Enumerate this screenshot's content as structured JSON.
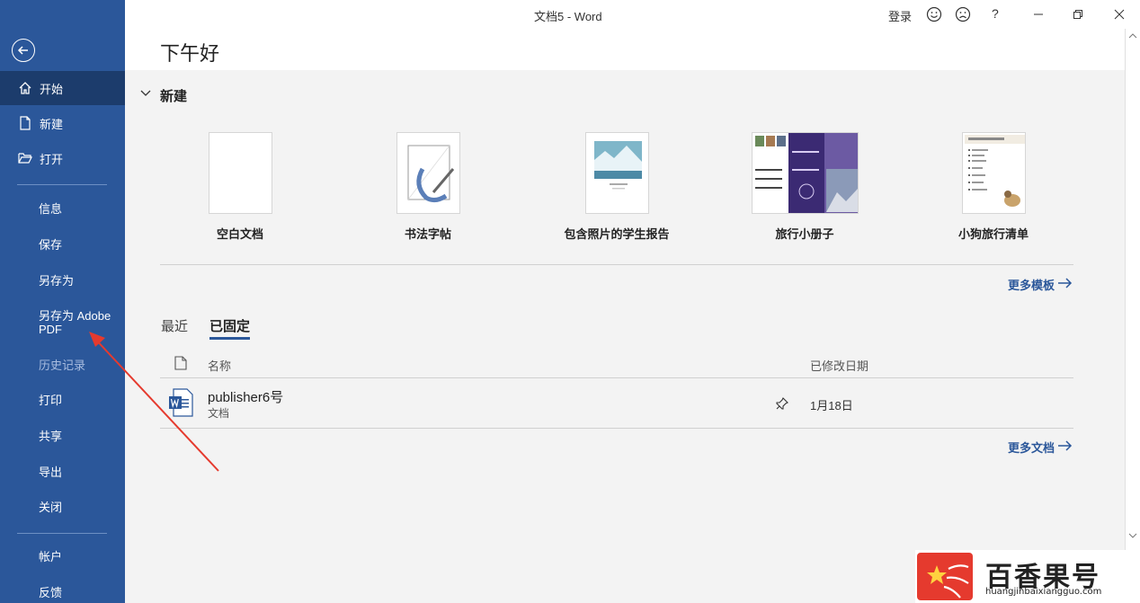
{
  "window": {
    "title": "文档5  -  Word",
    "login_label": "登录",
    "help_label": "?"
  },
  "sidebar": {
    "primary": [
      {
        "label": "开始",
        "icon": "home-icon",
        "active": true
      },
      {
        "label": "新建",
        "icon": "new-doc-icon"
      },
      {
        "label": "打开",
        "icon": "folder-open-icon"
      }
    ],
    "secondary": [
      {
        "label": "信息"
      },
      {
        "label": "保存"
      },
      {
        "label": "另存为"
      },
      {
        "label": "另存为 Adobe PDF"
      },
      {
        "label": "历史记录",
        "disabled": true
      },
      {
        "label": "打印"
      },
      {
        "label": "共享"
      },
      {
        "label": "导出"
      },
      {
        "label": "关闭"
      }
    ],
    "footer": [
      {
        "label": "帐户"
      },
      {
        "label": "反馈"
      }
    ]
  },
  "main": {
    "greeting": "下午好",
    "new_section": {
      "title": "新建",
      "templates": [
        {
          "label": "空白文档"
        },
        {
          "label": "书法字帖"
        },
        {
          "label": "包含照片的学生报告"
        },
        {
          "label": "旅行小册子"
        },
        {
          "label": "小狗旅行清单"
        }
      ],
      "more_label": "更多模板"
    },
    "recent_tabs": {
      "tabs": [
        "最近",
        "已固定"
      ],
      "active": "已固定"
    },
    "file_list": {
      "columns": {
        "name": "名称",
        "date": "已修改日期"
      },
      "rows": [
        {
          "name": "publisher6号",
          "type": "文档",
          "date": "1月18日",
          "pinned": true
        }
      ],
      "more_label": "更多文档"
    }
  },
  "watermark": {
    "brand": "百香果号",
    "url": "huangjinbaixiangguo.com"
  },
  "colors": {
    "sidebar": "#2b579a",
    "sidebar_active": "#1c3c6c",
    "accent": "#2b579a",
    "annotation_arrow": "#e53a2e"
  }
}
